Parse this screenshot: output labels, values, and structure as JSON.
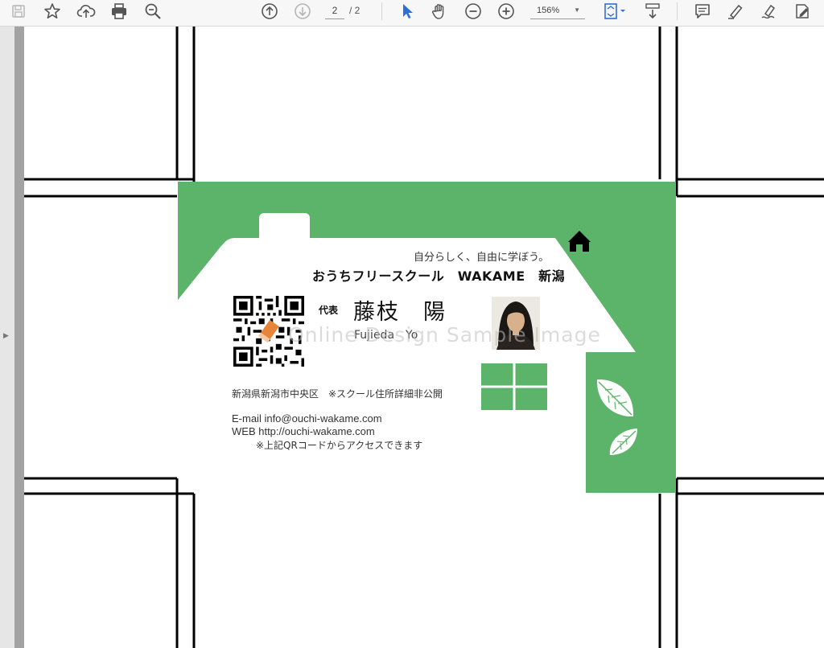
{
  "toolbar": {
    "tools": [
      "save-icon",
      "bookmark-star-icon",
      "upload-cloud-icon",
      "print-icon",
      "zoom-search-icon",
      "page-up-icon",
      "page-down-icon",
      "select-arrow-icon",
      "hand-pan-icon",
      "zoom-out-icon",
      "zoom-in-icon",
      "page-fit-icon",
      "scroll-mode-icon",
      "comment-icon",
      "highlight-icon",
      "sign-icon",
      "fill-sign-icon"
    ],
    "page_current": "2",
    "page_total": "/ 2",
    "zoom": "156%",
    "accent": "#2d6fd6"
  },
  "card": {
    "accent": "#5cb46a",
    "tagline": "自分らしく、自由に学ぼう。",
    "school_name": "おうちフリースクール　WAKAME　新潟",
    "role": "代表",
    "name_jp": "藤枝　陽",
    "name_en": "Fujieda　Yo",
    "watermark": "Online Design Sample Image",
    "address": "新潟県新潟市中央区　※スクール住所詳細非公開",
    "email": "E-mail info@ouchi-wakame.com",
    "web": "WEB http://ouchi-wakame.com",
    "qr_note": "※上記QRコードからアクセスできます",
    "icons": [
      "home-icon",
      "leaf-icon",
      "window-icon",
      "qr-code",
      "profile-photo"
    ]
  }
}
